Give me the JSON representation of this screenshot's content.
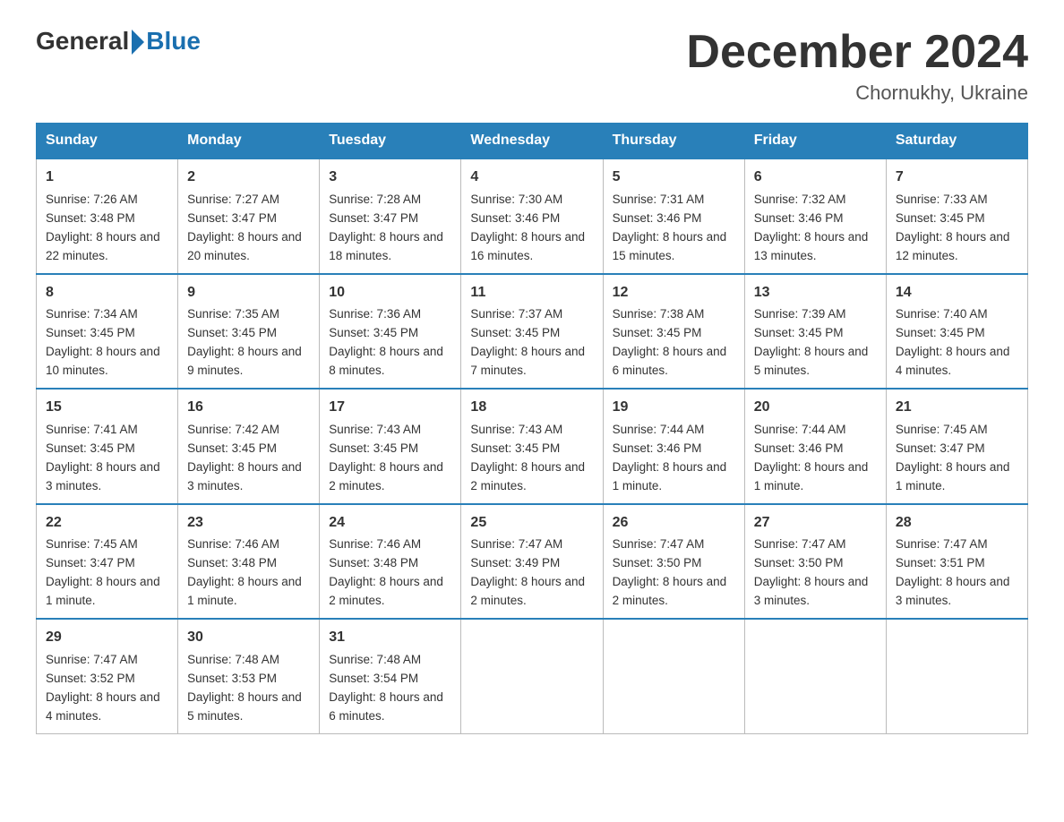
{
  "logo": {
    "general": "General",
    "blue": "Blue"
  },
  "title": "December 2024",
  "subtitle": "Chornukhy, Ukraine",
  "days_of_week": [
    "Sunday",
    "Monday",
    "Tuesday",
    "Wednesday",
    "Thursday",
    "Friday",
    "Saturday"
  ],
  "weeks": [
    [
      {
        "day": "1",
        "sunrise": "7:26 AM",
        "sunset": "3:48 PM",
        "daylight": "8 hours and 22 minutes."
      },
      {
        "day": "2",
        "sunrise": "7:27 AM",
        "sunset": "3:47 PM",
        "daylight": "8 hours and 20 minutes."
      },
      {
        "day": "3",
        "sunrise": "7:28 AM",
        "sunset": "3:47 PM",
        "daylight": "8 hours and 18 minutes."
      },
      {
        "day": "4",
        "sunrise": "7:30 AM",
        "sunset": "3:46 PM",
        "daylight": "8 hours and 16 minutes."
      },
      {
        "day": "5",
        "sunrise": "7:31 AM",
        "sunset": "3:46 PM",
        "daylight": "8 hours and 15 minutes."
      },
      {
        "day": "6",
        "sunrise": "7:32 AM",
        "sunset": "3:46 PM",
        "daylight": "8 hours and 13 minutes."
      },
      {
        "day": "7",
        "sunrise": "7:33 AM",
        "sunset": "3:45 PM",
        "daylight": "8 hours and 12 minutes."
      }
    ],
    [
      {
        "day": "8",
        "sunrise": "7:34 AM",
        "sunset": "3:45 PM",
        "daylight": "8 hours and 10 minutes."
      },
      {
        "day": "9",
        "sunrise": "7:35 AM",
        "sunset": "3:45 PM",
        "daylight": "8 hours and 9 minutes."
      },
      {
        "day": "10",
        "sunrise": "7:36 AM",
        "sunset": "3:45 PM",
        "daylight": "8 hours and 8 minutes."
      },
      {
        "day": "11",
        "sunrise": "7:37 AM",
        "sunset": "3:45 PM",
        "daylight": "8 hours and 7 minutes."
      },
      {
        "day": "12",
        "sunrise": "7:38 AM",
        "sunset": "3:45 PM",
        "daylight": "8 hours and 6 minutes."
      },
      {
        "day": "13",
        "sunrise": "7:39 AM",
        "sunset": "3:45 PM",
        "daylight": "8 hours and 5 minutes."
      },
      {
        "day": "14",
        "sunrise": "7:40 AM",
        "sunset": "3:45 PM",
        "daylight": "8 hours and 4 minutes."
      }
    ],
    [
      {
        "day": "15",
        "sunrise": "7:41 AM",
        "sunset": "3:45 PM",
        "daylight": "8 hours and 3 minutes."
      },
      {
        "day": "16",
        "sunrise": "7:42 AM",
        "sunset": "3:45 PM",
        "daylight": "8 hours and 3 minutes."
      },
      {
        "day": "17",
        "sunrise": "7:43 AM",
        "sunset": "3:45 PM",
        "daylight": "8 hours and 2 minutes."
      },
      {
        "day": "18",
        "sunrise": "7:43 AM",
        "sunset": "3:45 PM",
        "daylight": "8 hours and 2 minutes."
      },
      {
        "day": "19",
        "sunrise": "7:44 AM",
        "sunset": "3:46 PM",
        "daylight": "8 hours and 1 minute."
      },
      {
        "day": "20",
        "sunrise": "7:44 AM",
        "sunset": "3:46 PM",
        "daylight": "8 hours and 1 minute."
      },
      {
        "day": "21",
        "sunrise": "7:45 AM",
        "sunset": "3:47 PM",
        "daylight": "8 hours and 1 minute."
      }
    ],
    [
      {
        "day": "22",
        "sunrise": "7:45 AM",
        "sunset": "3:47 PM",
        "daylight": "8 hours and 1 minute."
      },
      {
        "day": "23",
        "sunrise": "7:46 AM",
        "sunset": "3:48 PM",
        "daylight": "8 hours and 1 minute."
      },
      {
        "day": "24",
        "sunrise": "7:46 AM",
        "sunset": "3:48 PM",
        "daylight": "8 hours and 2 minutes."
      },
      {
        "day": "25",
        "sunrise": "7:47 AM",
        "sunset": "3:49 PM",
        "daylight": "8 hours and 2 minutes."
      },
      {
        "day": "26",
        "sunrise": "7:47 AM",
        "sunset": "3:50 PM",
        "daylight": "8 hours and 2 minutes."
      },
      {
        "day": "27",
        "sunrise": "7:47 AM",
        "sunset": "3:50 PM",
        "daylight": "8 hours and 3 minutes."
      },
      {
        "day": "28",
        "sunrise": "7:47 AM",
        "sunset": "3:51 PM",
        "daylight": "8 hours and 3 minutes."
      }
    ],
    [
      {
        "day": "29",
        "sunrise": "7:47 AM",
        "sunset": "3:52 PM",
        "daylight": "8 hours and 4 minutes."
      },
      {
        "day": "30",
        "sunrise": "7:48 AM",
        "sunset": "3:53 PM",
        "daylight": "8 hours and 5 minutes."
      },
      {
        "day": "31",
        "sunrise": "7:48 AM",
        "sunset": "3:54 PM",
        "daylight": "8 hours and 6 minutes."
      },
      null,
      null,
      null,
      null
    ]
  ]
}
